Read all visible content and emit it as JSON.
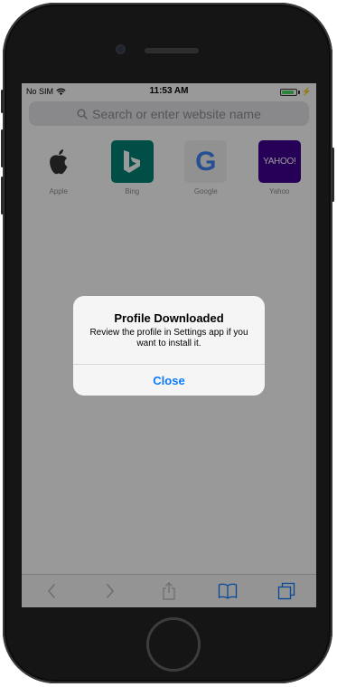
{
  "status_bar": {
    "carrier": "No SIM",
    "time": "11:53 AM",
    "charging_glyph": "⚡"
  },
  "url_bar": {
    "placeholder": "Search or enter website name"
  },
  "favorites": [
    {
      "label": "Apple"
    },
    {
      "label": "Bing"
    },
    {
      "label": "Google",
      "glyph": "G"
    },
    {
      "label": "Yahoo",
      "glyph": "YAHOO!"
    }
  ],
  "alert": {
    "title": "Profile Downloaded",
    "message": "Review the profile in Settings app if you want to install it.",
    "button": "Close"
  },
  "colors": {
    "accent": "#0a7aff",
    "bing_tile": "#008373",
    "yahoo_tile": "#400090",
    "battery": "#4cd964"
  },
  "toolbar": {
    "icons": [
      "back-icon",
      "forward-icon",
      "share-icon",
      "bookmarks-icon",
      "tabs-icon"
    ]
  }
}
